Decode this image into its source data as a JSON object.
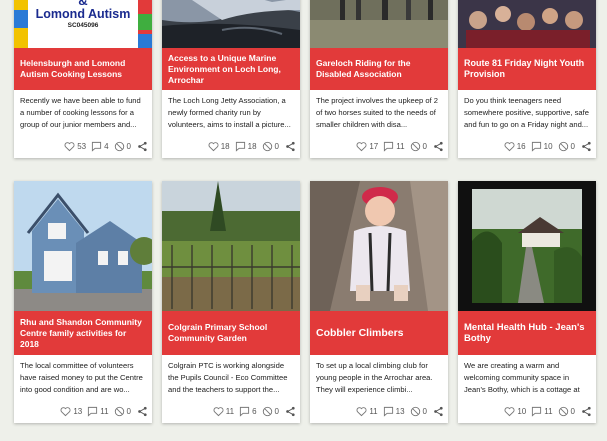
{
  "colors": {
    "title_bar": "#e23a3a",
    "background": "#eef0ea"
  },
  "cards": [
    {
      "logo_line1": "&",
      "logo_line2": "Lomond Autism",
      "logo_line3": "SC045096",
      "title": "Helensburgh and Lomond Autism Cooking Lessons",
      "description": "Recently we have been able to fund a number of cooking lessons for a group of our junior members and...",
      "likes": "53",
      "comments": "4",
      "flags": "0"
    },
    {
      "title": "Access to a Unique Marine Environment on Loch Long, Arrochar",
      "description": "The Loch Long Jetty Association, a newly formed charity run by volunteers, aims to install a picture...",
      "likes": "18",
      "comments": "18",
      "flags": "0"
    },
    {
      "title": "Gareloch Riding for the Disabled Association",
      "description": "The project involves the upkeep of 2 of two horses suited to the needs of smaller children with disa...",
      "likes": "17",
      "comments": "11",
      "flags": "0"
    },
    {
      "title": "Route 81 Friday Night Youth Provision",
      "description": "Do you think teenagers need somewhere positive, supportive, safe and fun to go on a Friday night and...",
      "likes": "16",
      "comments": "10",
      "flags": "0"
    },
    {
      "title": "Rhu and Shandon Community Centre family activities for 2018",
      "description": "The local committee of volunteers have raised money to put the Centre into good condition and are wo...",
      "likes": "13",
      "comments": "11",
      "flags": "0"
    },
    {
      "title": "Colgrain Primary School Community Garden",
      "description": "Colgrain PTC is working alongside the Pupils Council - Eco Committee and the teachers to support the...",
      "likes": "11",
      "comments": "6",
      "flags": "0"
    },
    {
      "title": "Cobbler Climbers",
      "description": "To set up a local climbing club for young people in the Arrochar area. They will experience climbi...",
      "likes": "11",
      "comments": "13",
      "flags": "0"
    },
    {
      "title": "Mental Health Hub - Jean's Bothy",
      "description": "We are creating a warm and welcoming community space in Jean's Bothy, which is a cottage at the hear...",
      "likes": "10",
      "comments": "11",
      "flags": "0"
    }
  ]
}
